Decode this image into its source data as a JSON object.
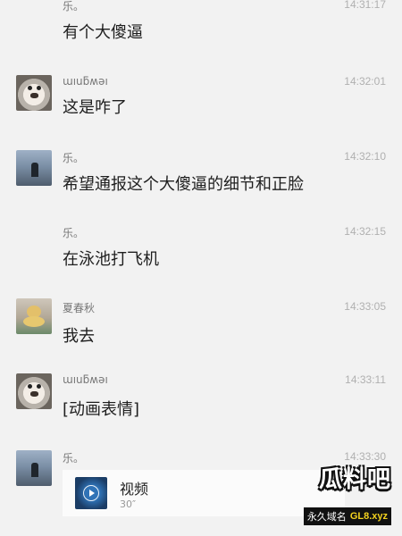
{
  "messages": [
    {
      "sender": "乐。",
      "time": "14:31:17",
      "text": "有个大傻逼",
      "avatar": "night-figure-avatar",
      "name_flipped": false,
      "show_avatar": false
    },
    {
      "sender": "ɯıuƃʍəı",
      "time": "14:32:01",
      "text": "这是咋了",
      "avatar": "dog-avatar",
      "name_flipped": false,
      "show_avatar": true
    },
    {
      "sender": "乐。",
      "time": "14:32:10",
      "text": "希望通报这个大傻逼的细节和正脸",
      "avatar": "night-figure-avatar",
      "name_flipped": false,
      "show_avatar": true
    },
    {
      "sender": "乐。",
      "time": "14:32:15",
      "text": "在泳池打飞机",
      "avatar": "night-figure-avatar",
      "name_flipped": false,
      "show_avatar": false
    },
    {
      "sender": "夏春秋",
      "time": "14:33:05",
      "text": "我去",
      "avatar": "duck-avatar",
      "name_flipped": false,
      "show_avatar": true
    },
    {
      "sender": "ɯıuƃʍəı",
      "time": "14:33:11",
      "text": "[动画表情]",
      "avatar": "dog-avatar",
      "name_flipped": false,
      "show_avatar": true
    },
    {
      "sender": "乐。",
      "time": "14:33:30",
      "avatar": "night-figure-avatar",
      "show_avatar": true,
      "video": {
        "label": "视频",
        "duration": "30″"
      }
    }
  ],
  "watermark": {
    "title": "瓜料吧",
    "sub_cn": "永久域名",
    "sub_domain": "GL8.xyz"
  }
}
